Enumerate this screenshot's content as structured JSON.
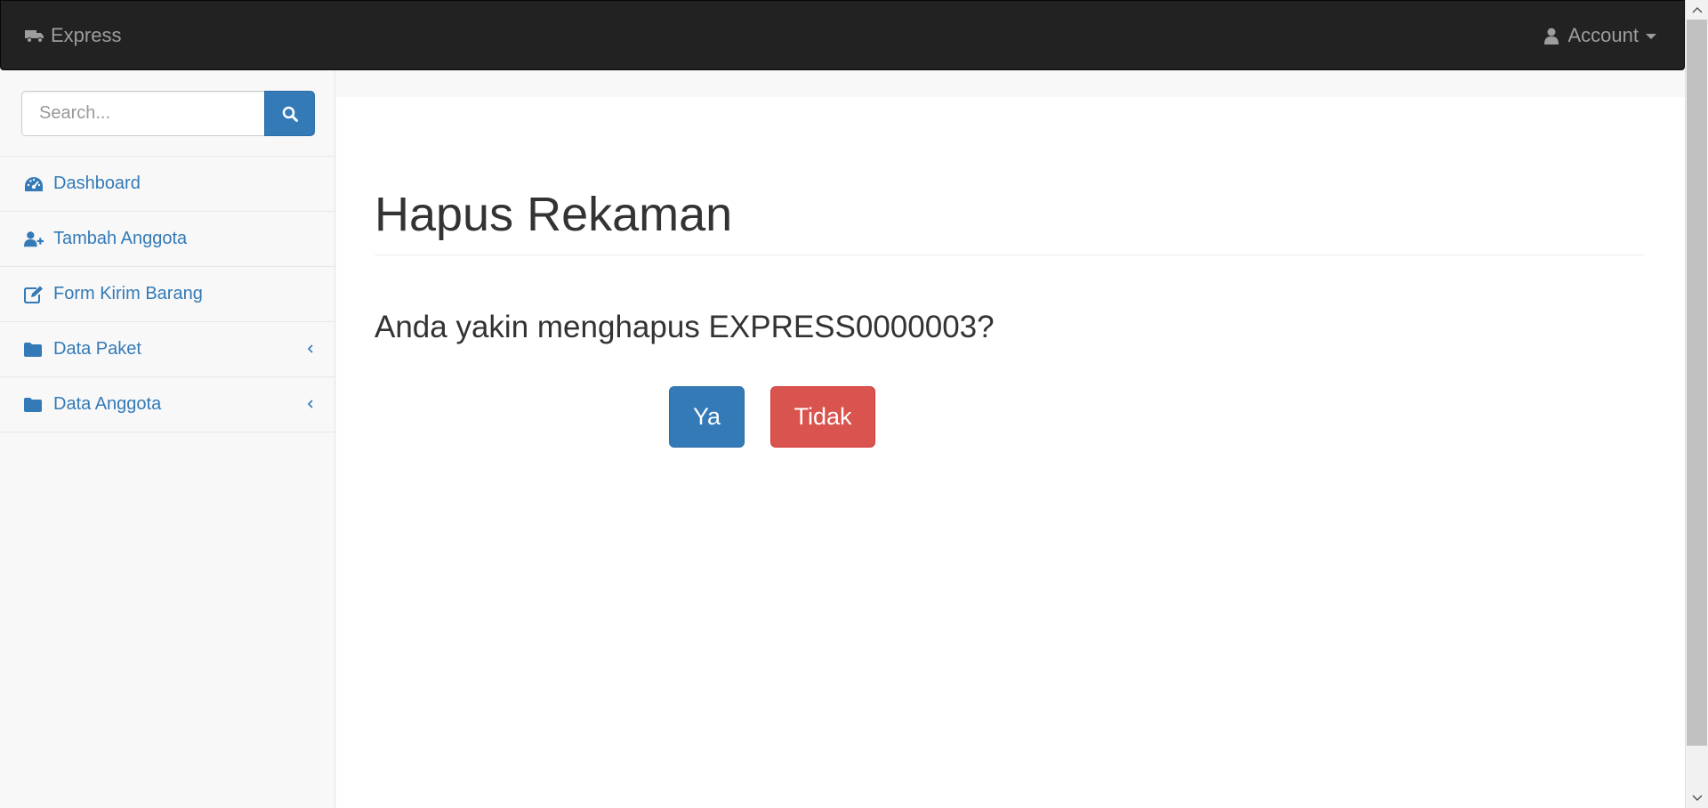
{
  "navbar": {
    "brand_label": "Express",
    "brand_icon": "truck-icon",
    "account_label": "Account",
    "account_icon": "user-icon"
  },
  "sidebar": {
    "search": {
      "placeholder": "Search...",
      "value": "",
      "button_icon": "search-icon"
    },
    "items": [
      {
        "label": "Dashboard",
        "icon": "dashboard-icon",
        "has_submenu": false
      },
      {
        "label": "Tambah Anggota",
        "icon": "user-plus-icon",
        "has_submenu": false
      },
      {
        "label": "Form Kirim Barang",
        "icon": "edit-icon",
        "has_submenu": false
      },
      {
        "label": "Data Paket",
        "icon": "folder-icon",
        "has_submenu": true
      },
      {
        "label": "Data Anggota",
        "icon": "folder-icon",
        "has_submenu": true
      }
    ]
  },
  "main": {
    "title": "Hapus Rekaman",
    "confirm_text": "Anda yakin menghapus EXPRESS0000003?",
    "yes_label": "Ya",
    "no_label": "Tidak"
  },
  "colors": {
    "navbar_bg": "#222222",
    "link": "#337ab7",
    "primary": "#337ab7",
    "danger": "#d9534f",
    "sidebar_bg": "#f8f8f8"
  }
}
